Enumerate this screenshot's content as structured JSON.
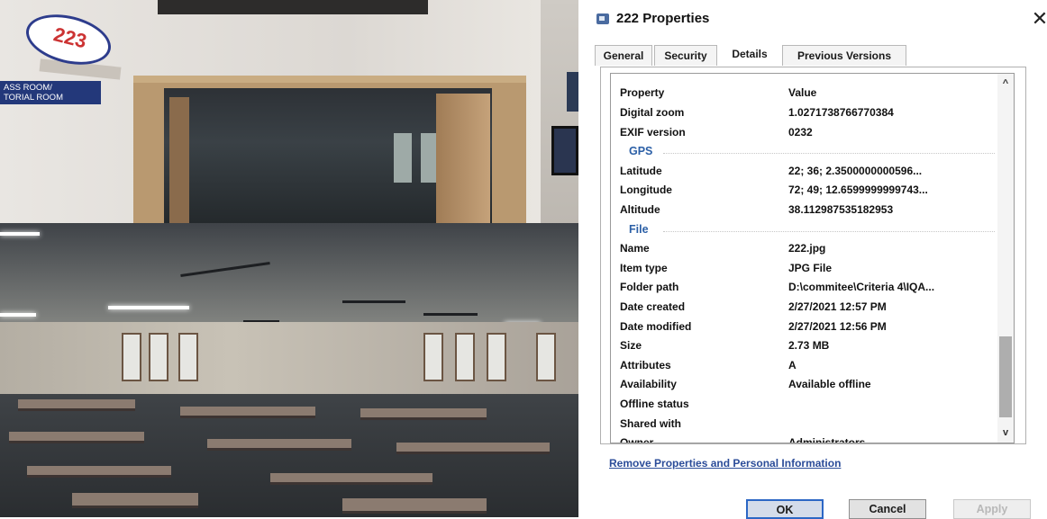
{
  "photo": {
    "sign_number": "223",
    "sign_room_line1": "ASS ROOM/",
    "sign_room_line2": "TORIAL ROOM"
  },
  "dialog": {
    "title": "222 Properties",
    "close_glyph": "✕",
    "icon": "image-file-icon",
    "tabs": [
      {
        "label": "General",
        "active": false
      },
      {
        "label": "Security",
        "active": false
      },
      {
        "label": "Details",
        "active": true
      },
      {
        "label": "Previous Versions",
        "active": false
      }
    ],
    "header": {
      "property": "Property",
      "value": "Value"
    },
    "rows": [
      {
        "k": "Digital zoom",
        "v": "1.0271738766770384"
      },
      {
        "k": "EXIF version",
        "v": "0232"
      },
      {
        "group": "GPS"
      },
      {
        "k": "Latitude",
        "v": "22; 36; 2.3500000000596..."
      },
      {
        "k": "Longitude",
        "v": "72; 49; 12.6599999999743..."
      },
      {
        "k": "Altitude",
        "v": "38.112987535182953"
      },
      {
        "group": "File"
      },
      {
        "k": "Name",
        "v": "222.jpg"
      },
      {
        "k": "Item type",
        "v": "JPG File"
      },
      {
        "k": "Folder path",
        "v": "D:\\commitee\\Criteria 4\\IQA..."
      },
      {
        "k": "Date created",
        "v": "2/27/2021 12:57 PM"
      },
      {
        "k": "Date modified",
        "v": "2/27/2021 12:56 PM"
      },
      {
        "k": "Size",
        "v": "2.73 MB"
      },
      {
        "k": "Attributes",
        "v": "A"
      },
      {
        "k": "Availability",
        "v": "Available offline"
      },
      {
        "k": "Offline status",
        "v": ""
      },
      {
        "k": "Shared with",
        "v": ""
      },
      {
        "k": "Owner",
        "v": "Administrators"
      }
    ],
    "remove_link": "Remove Properties and Personal Information",
    "buttons": {
      "ok": "OK",
      "cancel": "Cancel",
      "apply": "Apply"
    },
    "scroll_up": "^",
    "scroll_down": "v"
  }
}
